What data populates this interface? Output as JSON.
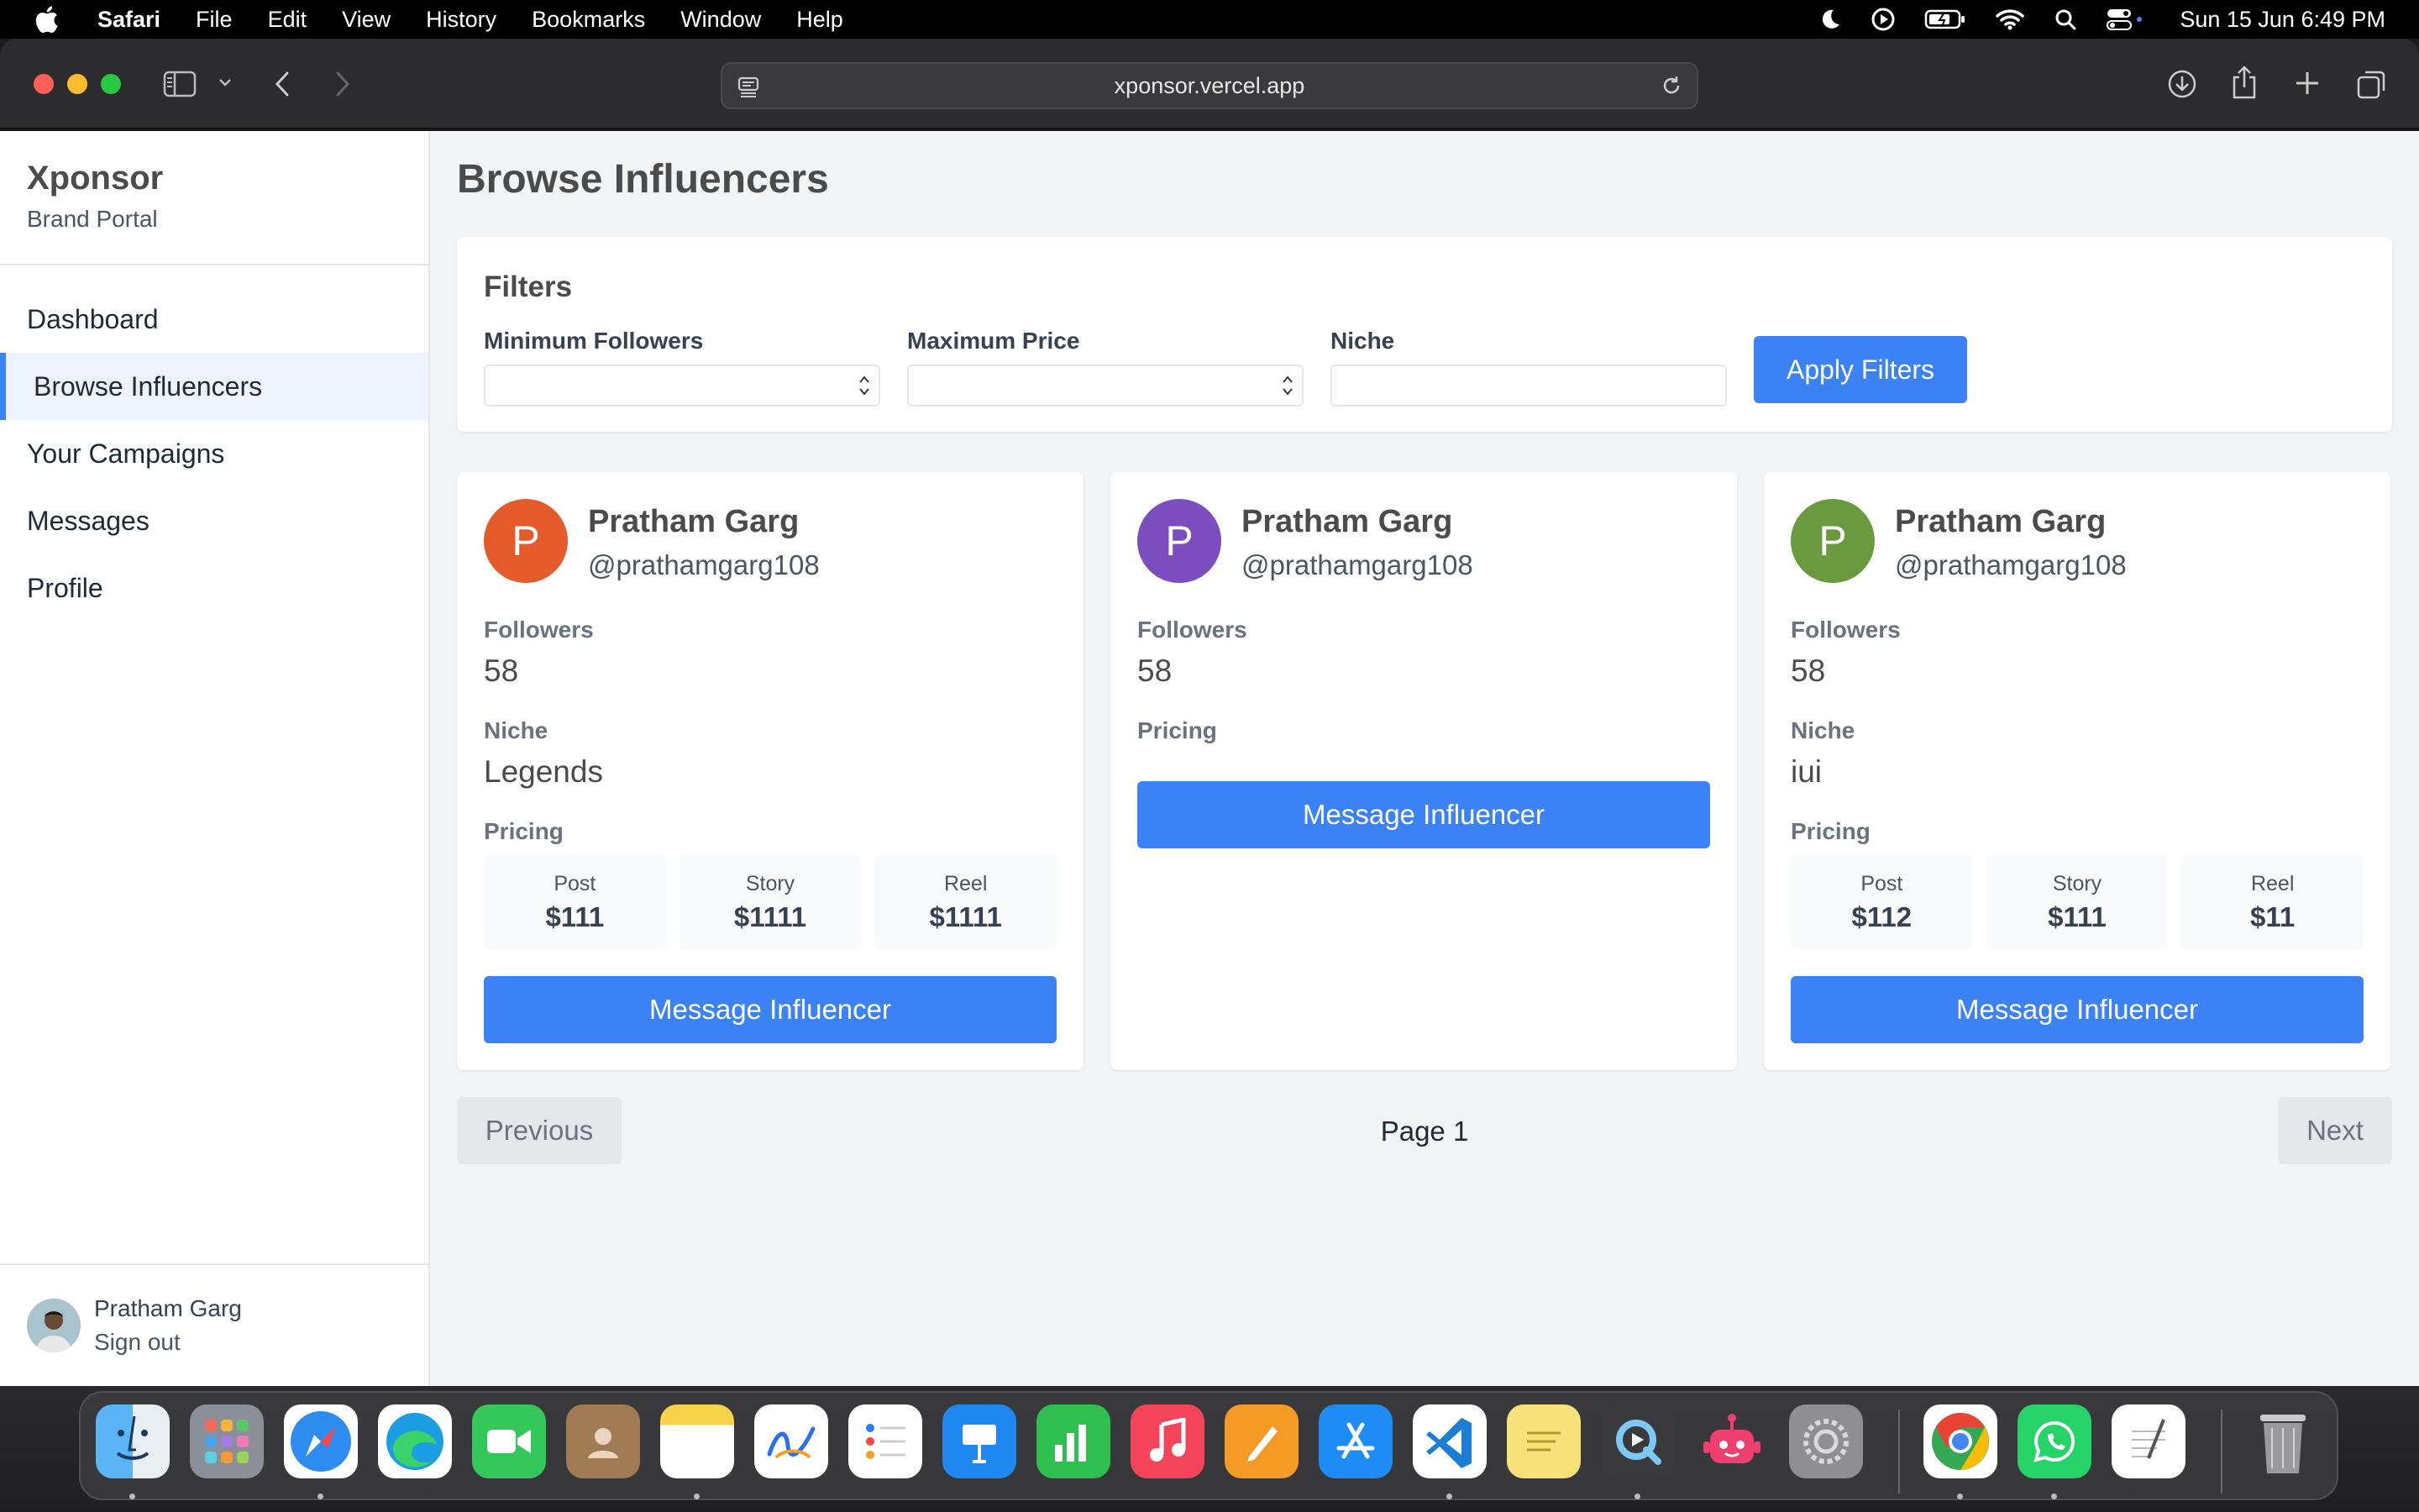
{
  "menubar": {
    "app": "Safari",
    "items": [
      "File",
      "Edit",
      "View",
      "History",
      "Bookmarks",
      "Window",
      "Help"
    ],
    "clock": "Sun 15 Jun  6:49 PM"
  },
  "browser": {
    "url": "xponsor.vercel.app"
  },
  "sidebar": {
    "brand": "Xponsor",
    "subtitle": "Brand Portal",
    "items": [
      {
        "label": "Dashboard"
      },
      {
        "label": "Browse Influencers"
      },
      {
        "label": "Your Campaigns"
      },
      {
        "label": "Messages"
      },
      {
        "label": "Profile"
      }
    ],
    "active_index": 1,
    "user": {
      "name": "Pratham Garg",
      "signout": "Sign out"
    }
  },
  "main": {
    "title": "Browse Influencers",
    "filters": {
      "title": "Filters",
      "min_followers_label": "Minimum Followers",
      "max_price_label": "Maximum Price",
      "niche_label": "Niche",
      "apply_label": "Apply Filters"
    },
    "cards": [
      {
        "initial": "P",
        "color": "#e45a2b",
        "name": "Pratham Garg",
        "handle": "@prathamgarg108",
        "followers_label": "Followers",
        "followers": "58",
        "niche_label": "Niche",
        "niche": "Legends",
        "pricing_label": "Pricing",
        "prices": [
          {
            "label": "Post",
            "value": "$111"
          },
          {
            "label": "Story",
            "value": "$1111"
          },
          {
            "label": "Reel",
            "value": "$1111"
          }
        ],
        "button": "Message Influencer"
      },
      {
        "initial": "P",
        "color": "#7c4dbf",
        "name": "Pratham Garg",
        "handle": "@prathamgarg108",
        "followers_label": "Followers",
        "followers": "58",
        "pricing_label": "Pricing",
        "button": "Message Influencer"
      },
      {
        "initial": "P",
        "color": "#6a9a3e",
        "name": "Pratham Garg",
        "handle": "@prathamgarg108",
        "followers_label": "Followers",
        "followers": "58",
        "niche_label": "Niche",
        "niche": "iui",
        "pricing_label": "Pricing",
        "prices": [
          {
            "label": "Post",
            "value": "$112"
          },
          {
            "label": "Story",
            "value": "$111"
          },
          {
            "label": "Reel",
            "value": "$11"
          }
        ],
        "button": "Message Influencer"
      }
    ],
    "pagination": {
      "previous": "Previous",
      "page": "Page 1",
      "next": "Next"
    }
  },
  "dock": {
    "apps": [
      "finder-icon",
      "launchpad-icon",
      "safari-icon",
      "edge-icon",
      "facetime-icon",
      "contacts-icon",
      "notes-icon",
      "freeform-icon",
      "reminders-icon",
      "keynote-icon",
      "numbers-icon",
      "music-icon",
      "pages-icon",
      "app-store-icon",
      "vscode-icon",
      "stickies-icon",
      "quicktime-icon",
      "robot-app-icon",
      "system-settings-icon",
      "chrome-icon",
      "whatsapp-icon",
      "textedit-icon",
      "trash-icon"
    ]
  },
  "colors": {
    "accent": "#3b82f6",
    "active_nav_bg": "#eef4ff"
  }
}
